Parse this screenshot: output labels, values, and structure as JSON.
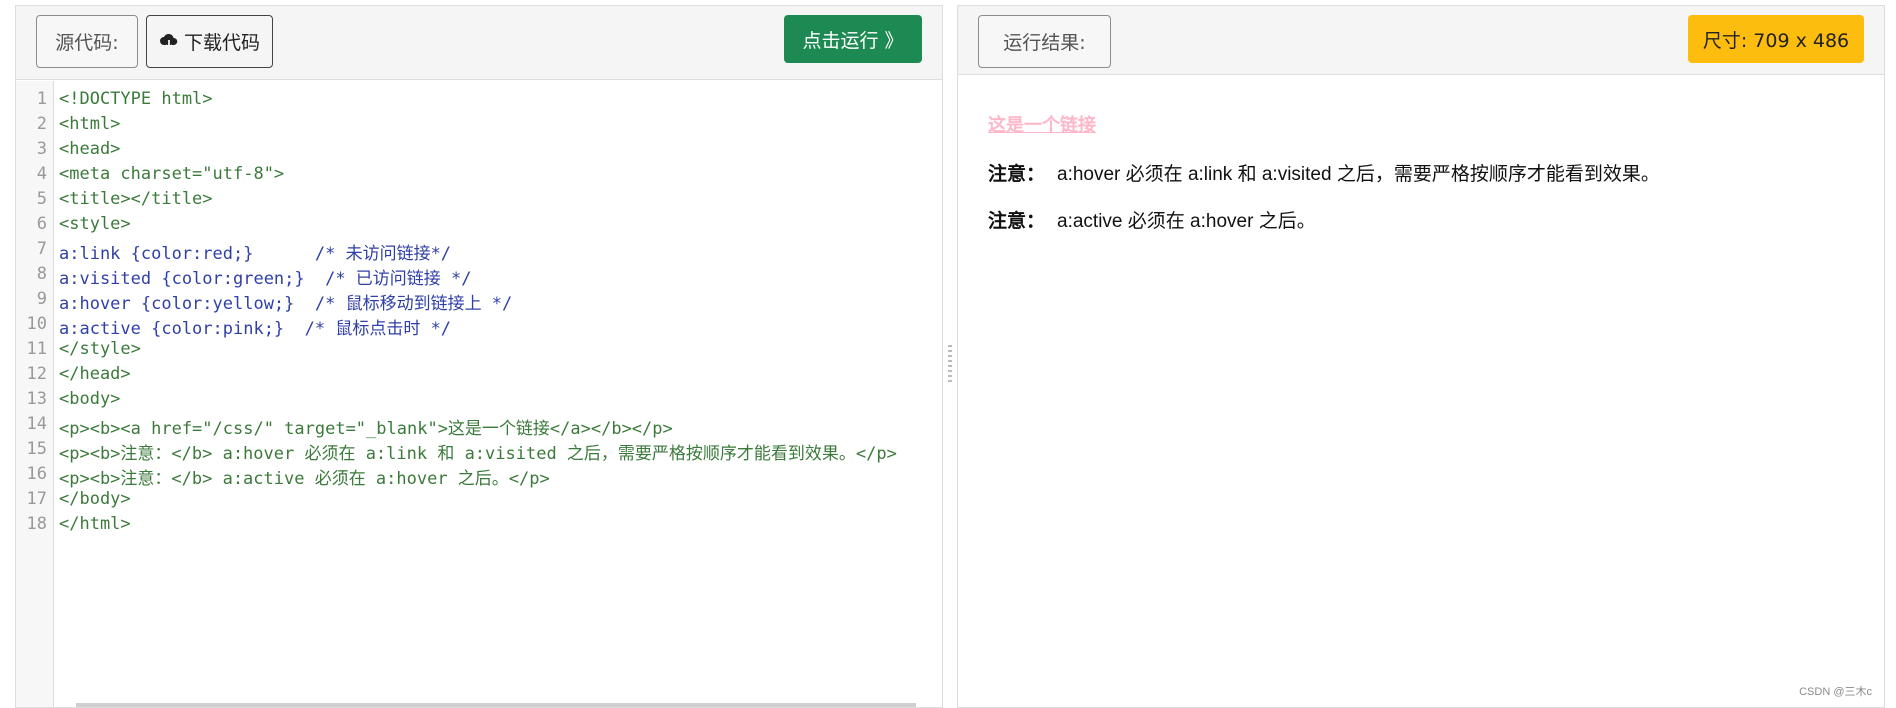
{
  "editor_panel": {
    "source_label": "源代码:",
    "download_label": "下载代码",
    "run_label": "点击运行 》"
  },
  "code": {
    "line_numbers": [
      "1",
      "2",
      "3",
      "4",
      "5",
      "6",
      "7",
      "8",
      "9",
      "10",
      "11",
      "12",
      "13",
      "14",
      "15",
      "16",
      "17",
      "18"
    ],
    "lines": [
      "<!DOCTYPE html>",
      "<html>",
      "<head>",
      "<meta charset=\"utf-8\">",
      "<title></title>",
      "<style>",
      "a:link {color:red;}      /* 未访问链接*/",
      "a:visited {color:green;}  /* 已访问链接 */",
      "a:hover {color:yellow;}  /* 鼠标移动到链接上 */",
      "a:active {color:pink;}  /* 鼠标点击时 */",
      "</style>",
      "</head>",
      "<body>",
      "<p><b><a href=\"/css/\" target=\"_blank\">这是一个链接</a></b></p>",
      "<p><b>注意：</b> a:hover 必须在 a:link 和 a:visited 之后，需要严格按顺序才能看到效果。</p>",
      "<p><b>注意：</b> a:active 必须在 a:hover 之后。</p>",
      "</body>",
      "</html>"
    ]
  },
  "result_panel": {
    "result_label": "运行结果:",
    "size_label": "尺寸: 709 x 486",
    "link_text": "这是一个链接",
    "note1_label": "注意：",
    "note1_text": "a:hover 必须在 a:link 和 a:visited 之后，需要严格按顺序才能看到效果。",
    "note2_label": "注意：",
    "note2_text": "a:active 必须在 a:hover 之后。"
  },
  "watermark": "CSDN @三木c",
  "colors": {
    "run_button": "#1e8a53",
    "size_badge": "#fdbd0e",
    "link_pink": "#ffb6c8"
  }
}
